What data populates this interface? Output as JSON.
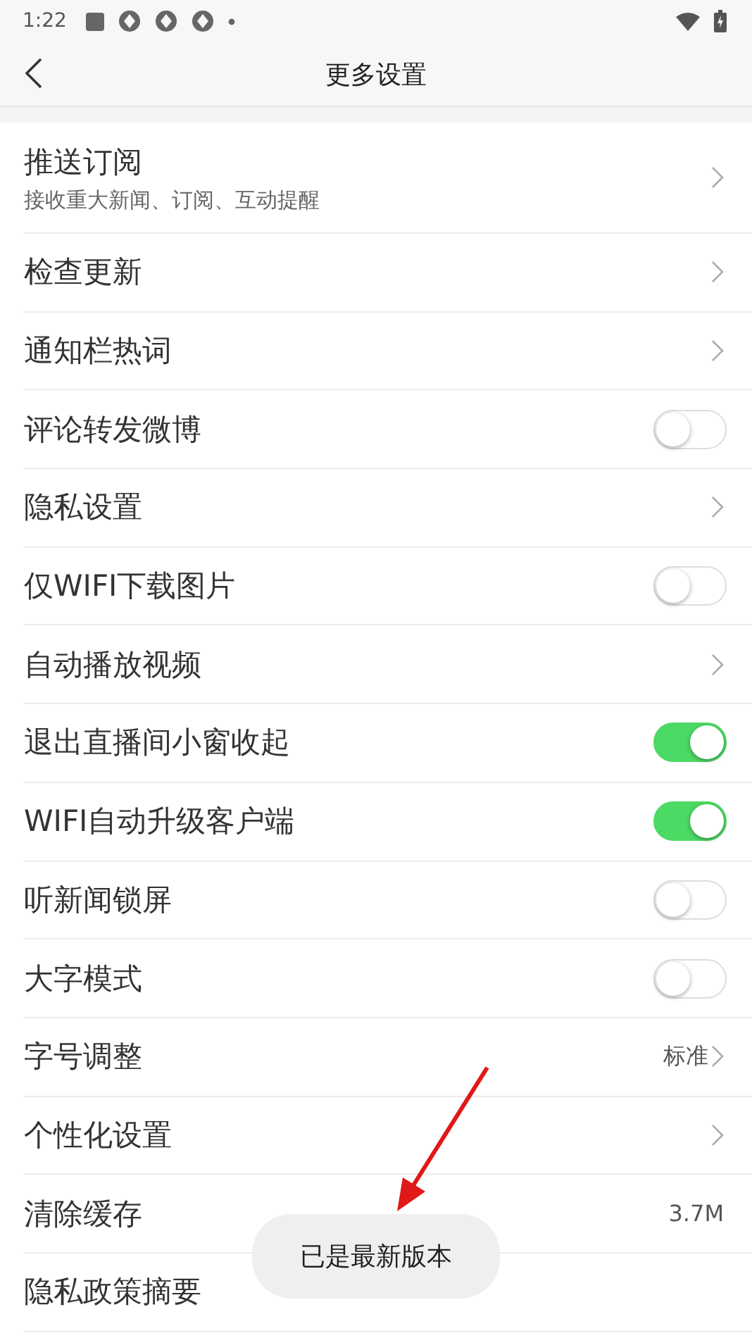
{
  "status_bar": {
    "time": "1:22"
  },
  "header": {
    "title": "更多设置"
  },
  "settings": [
    {
      "kind": "link",
      "label": "推送订阅",
      "subtitle": "接收重大新闻、订阅、互动提醒"
    },
    {
      "kind": "link",
      "label": "检查更新"
    },
    {
      "kind": "link",
      "label": "通知栏热词"
    },
    {
      "kind": "toggle",
      "label": "评论转发微博",
      "on": false
    },
    {
      "kind": "link",
      "label": "隐私设置"
    },
    {
      "kind": "toggle",
      "label": "仅WIFI下载图片",
      "on": false
    },
    {
      "kind": "link",
      "label": "自动播放视频"
    },
    {
      "kind": "toggle",
      "label": "退出直播间小窗收起",
      "on": true
    },
    {
      "kind": "toggle",
      "label": "WIFI自动升级客户端",
      "on": true
    },
    {
      "kind": "toggle",
      "label": "听新闻锁屏",
      "on": false
    },
    {
      "kind": "toggle",
      "label": "大字模式",
      "on": false
    },
    {
      "kind": "value-link",
      "label": "字号调整",
      "value": "标准"
    },
    {
      "kind": "link",
      "label": "个性化设置"
    },
    {
      "kind": "value",
      "label": "清除缓存",
      "value": "3.7M"
    },
    {
      "kind": "plain",
      "label": "隐私政策摘要"
    }
  ],
  "toast": {
    "text": "已是最新版本"
  }
}
